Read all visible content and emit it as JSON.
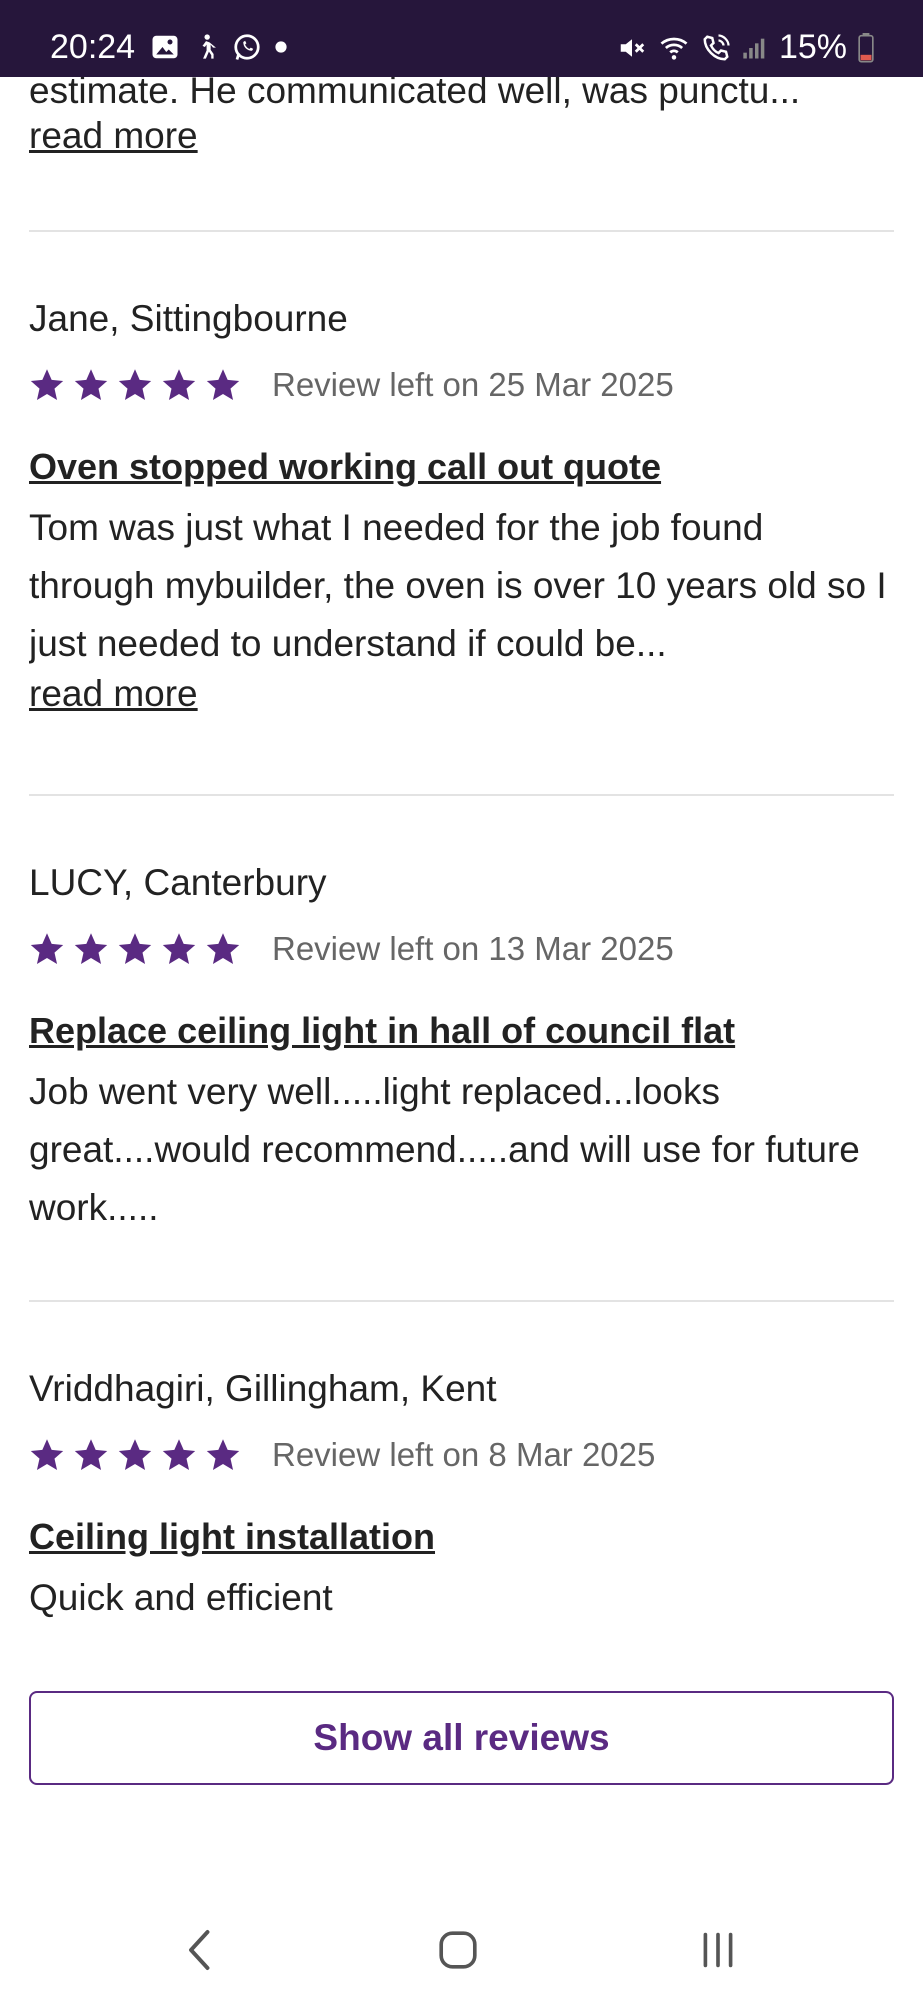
{
  "status_bar": {
    "time": "20:24",
    "icons_left": [
      "image-icon",
      "walking-person-icon",
      "whatsapp-icon",
      "dot-icon"
    ],
    "icons_right": [
      "mute-icon",
      "wifi-icon",
      "wifi-calling-icon",
      "signal-icon"
    ],
    "battery": "15%",
    "battery_color": "#e05a4f"
  },
  "previous_review": {
    "snippet": "estimate. He communicated well, was punctu...",
    "read_more": "read more"
  },
  "reviews": [
    {
      "reviewer": "Jane, Sittingbourne",
      "rating": 5,
      "date": "Review left on 25 Mar 2025",
      "title": "Oven stopped working call out quote",
      "body": "Tom was just what I needed for the job found through mybuilder, the oven is over 10 years old so I just needed to understand if could be...",
      "read_more": "read more"
    },
    {
      "reviewer": "LUCY, Canterbury",
      "rating": 5,
      "date": "Review left on 13 Mar 2025",
      "title": "Replace ceiling light in hall of council flat",
      "body": "Job went very well.....light replaced...looks great....would recommend.....and will use for future work....."
    },
    {
      "reviewer": "Vriddhagiri, Gillingham, Kent",
      "rating": 5,
      "date": "Review left on 8 Mar 2025",
      "title": "Ceiling light installation",
      "body": "Quick and efficient"
    }
  ],
  "show_all_button": "Show all reviews",
  "colors": {
    "accent": "#5a2a82",
    "star": "#5a2a82",
    "status_bar_bg": "#26163b",
    "divider": "#e3e3e3"
  },
  "nav_bar": [
    "back-icon",
    "home-icon",
    "recents-icon"
  ]
}
